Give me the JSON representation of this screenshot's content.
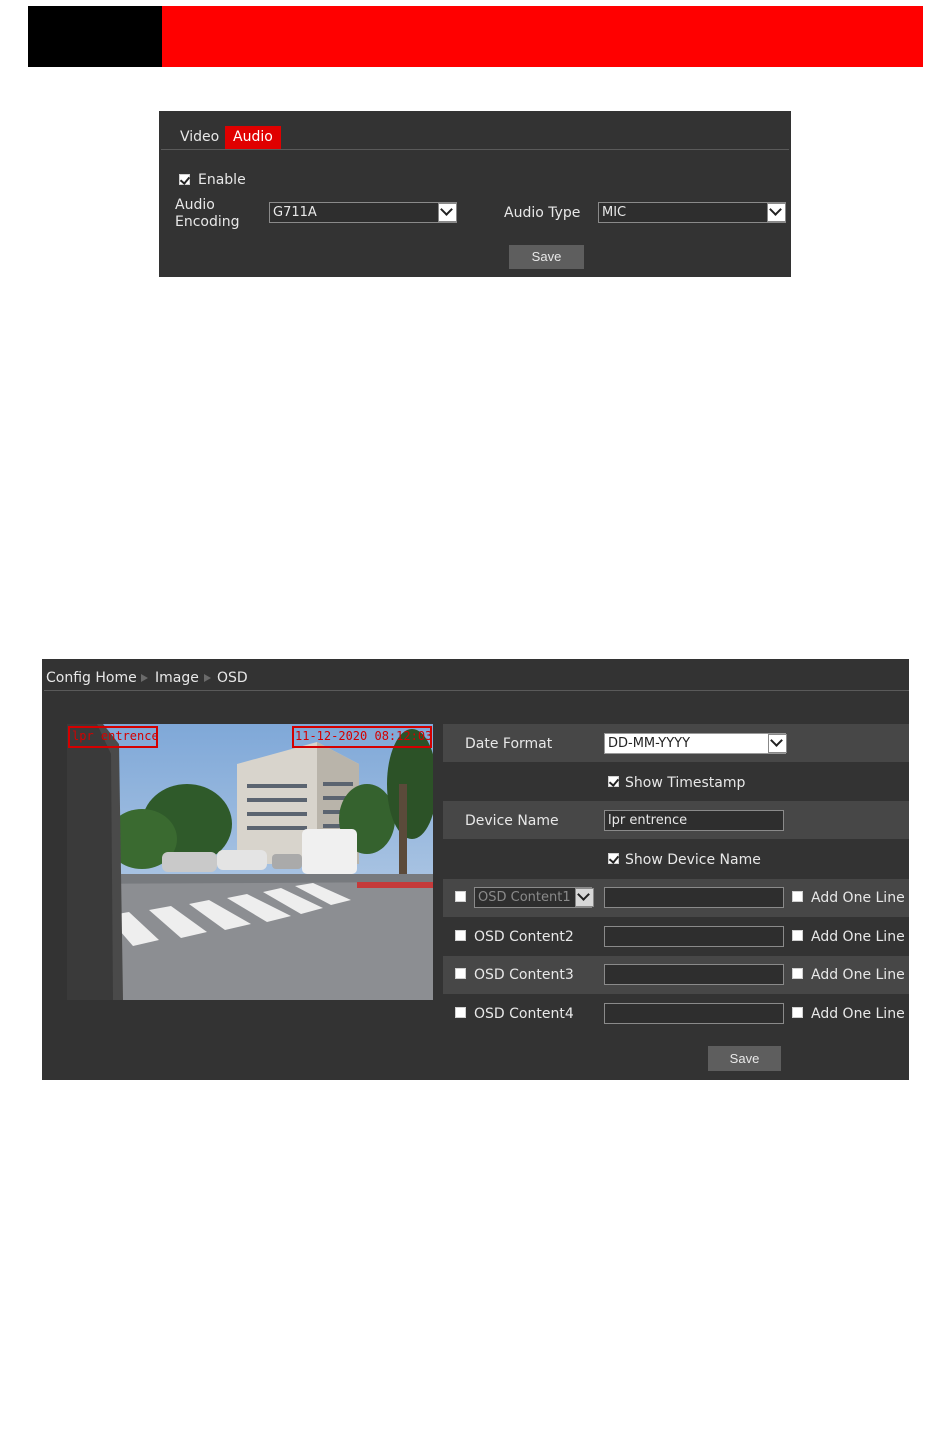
{
  "audio_panel": {
    "tabs": [
      {
        "label": "Video"
      },
      {
        "label": "Audio"
      }
    ],
    "enable_label": "Enable",
    "enable_checked": true,
    "audio_encoding_label_line1": "Audio",
    "audio_encoding_label_line2": "Encoding",
    "audio_encoding_value": "G711A",
    "audio_type_label": "Audio Type",
    "audio_type_value": "MIC",
    "save_label": "Save"
  },
  "osd_panel": {
    "breadcrumb": {
      "home": "Config Home",
      "section": "Image",
      "page": "OSD",
      "separator_icon": "triangle-right-icon"
    },
    "preview_overlay": {
      "device_name_text": "lpr entrence",
      "timestamp_text": "11-12-2020 08:12:03"
    },
    "date_format_label": "Date Format",
    "date_format_value": "DD-MM-YYYY",
    "show_timestamp_label": "Show Timestamp",
    "show_timestamp_checked": true,
    "device_name_label": "Device Name",
    "device_name_value": "lpr entrence",
    "show_device_name_label": "Show Device Name",
    "show_device_name_checked": true,
    "osd_contents": [
      {
        "label": "OSD Content1",
        "is_dropdown": true,
        "add_line_label": "Add One Line"
      },
      {
        "label": "OSD Content2",
        "is_dropdown": false,
        "add_line_label": "Add One Line"
      },
      {
        "label": "OSD Content3",
        "is_dropdown": false,
        "add_line_label": "Add One Line"
      },
      {
        "label": "OSD Content4",
        "is_dropdown": false,
        "add_line_label": "Add One Line"
      }
    ],
    "save_label": "Save"
  },
  "colors": {
    "header_red": "#ff0000",
    "header_black": "#000000",
    "panel_bg": "#333333",
    "active_tab": "#e00000",
    "overlay_red": "#d40000"
  }
}
